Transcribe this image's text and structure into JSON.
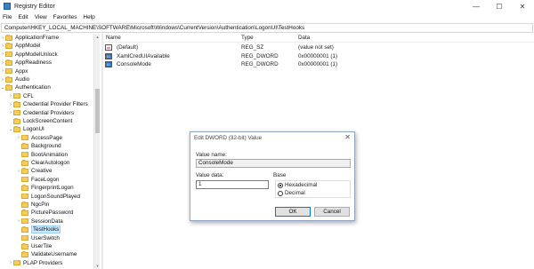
{
  "window": {
    "title": "Registry Editor",
    "controls": {
      "minimize": "—",
      "maximize": "☐",
      "close": "✕"
    }
  },
  "menu": [
    "File",
    "Edit",
    "View",
    "Favorites",
    "Help"
  ],
  "address": "Computer\\HKEY_LOCAL_MACHINE\\SOFTWARE\\Microsoft\\Windows\\CurrentVersion\\Authentication\\LogonUI\\TestHooks",
  "tree": {
    "items": [
      {
        "label": "ApplicationFrame",
        "level": 0,
        "expander": "›"
      },
      {
        "label": "AppModel",
        "level": 0,
        "expander": "›"
      },
      {
        "label": "AppModelUnlock",
        "level": 0,
        "expander": "›"
      },
      {
        "label": "AppReadiness",
        "level": 0,
        "expander": "›"
      },
      {
        "label": "Appx",
        "level": 0,
        "expander": "›"
      },
      {
        "label": "Audio",
        "level": 0,
        "expander": "›"
      },
      {
        "label": "Authentication",
        "level": 0,
        "expander": "⌄"
      },
      {
        "label": "CFL",
        "level": 1,
        "expander": "›"
      },
      {
        "label": "Credential Provider Filters",
        "level": 1,
        "expander": "›"
      },
      {
        "label": "Credential Providers",
        "level": 1,
        "expander": "›"
      },
      {
        "label": "LockScreenContent",
        "level": 1,
        "expander": ""
      },
      {
        "label": "LogonUI",
        "level": 1,
        "expander": "⌄"
      },
      {
        "label": "AccessPage",
        "level": 2,
        "expander": "›"
      },
      {
        "label": "Background",
        "level": 2,
        "expander": ""
      },
      {
        "label": "BootAnimation",
        "level": 2,
        "expander": ""
      },
      {
        "label": "ClearAutologon",
        "level": 2,
        "expander": ""
      },
      {
        "label": "Creative",
        "level": 2,
        "expander": "›"
      },
      {
        "label": "FaceLogon",
        "level": 2,
        "expander": ""
      },
      {
        "label": "FingerprintLogon",
        "level": 2,
        "expander": ""
      },
      {
        "label": "LogonSoundPlayed",
        "level": 2,
        "expander": ""
      },
      {
        "label": "NgcPin",
        "level": 2,
        "expander": ""
      },
      {
        "label": "PicturePassword",
        "level": 2,
        "expander": ""
      },
      {
        "label": "SessionData",
        "level": 2,
        "expander": "›"
      },
      {
        "label": "TestHooks",
        "level": 2,
        "expander": "",
        "selected": true
      },
      {
        "label": "UserSwitch",
        "level": 2,
        "expander": ""
      },
      {
        "label": "UserTile",
        "level": 2,
        "expander": ""
      },
      {
        "label": "ValidateUsername",
        "level": 2,
        "expander": ""
      },
      {
        "label": "PLAP Providers",
        "level": 1,
        "expander": "›"
      }
    ]
  },
  "list": {
    "headers": {
      "name": "Name",
      "type": "Type",
      "data": "Data"
    },
    "rows": [
      {
        "icon": "string-value-icon",
        "glyph": "ab",
        "name": "(Default)",
        "type": "REG_SZ",
        "data": "(value not set)"
      },
      {
        "icon": "dword-value-icon",
        "glyph": "01",
        "name": "XamlCredUIAvailable",
        "type": "REG_DWORD",
        "data": "0x00000001 (1)"
      },
      {
        "icon": "dword-value-icon",
        "glyph": "01",
        "name": "ConsoleMode",
        "type": "REG_DWORD",
        "data": "0x00000001 (1)"
      }
    ]
  },
  "dialog": {
    "title": "Edit DWORD (32-bit) Value",
    "close": "✕",
    "value_name_label": "Value name:",
    "value_name": "ConsoleMode",
    "value_data_label": "Value data:",
    "value_data": "1",
    "base_label": "Base",
    "base_options": [
      "Hexadecimal",
      "Decimal"
    ],
    "base_selected": "Hexadecimal",
    "ok": "OK",
    "cancel": "Cancel"
  }
}
